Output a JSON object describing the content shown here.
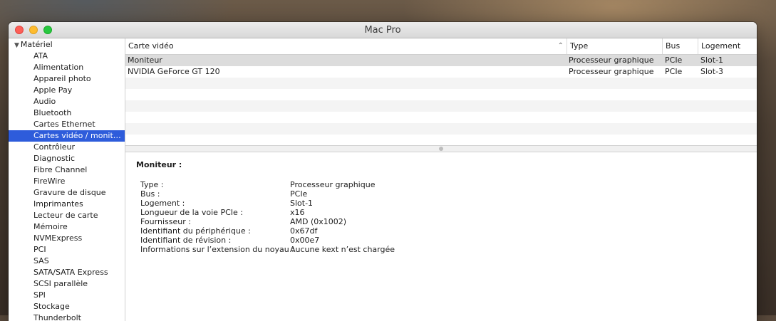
{
  "window": {
    "title": "Mac Pro"
  },
  "sidebar": {
    "header": "Matériel",
    "items": [
      {
        "label": "ATA"
      },
      {
        "label": "Alimentation"
      },
      {
        "label": "Appareil photo"
      },
      {
        "label": "Apple Pay"
      },
      {
        "label": "Audio"
      },
      {
        "label": "Bluetooth"
      },
      {
        "label": "Cartes Ethernet"
      },
      {
        "label": "Cartes vidéo / monite…"
      },
      {
        "label": "Contrôleur"
      },
      {
        "label": "Diagnostic"
      },
      {
        "label": "Fibre Channel"
      },
      {
        "label": "FireWire"
      },
      {
        "label": "Gravure de disque"
      },
      {
        "label": "Imprimantes"
      },
      {
        "label": "Lecteur de carte"
      },
      {
        "label": "Mémoire"
      },
      {
        "label": "NVMExpress"
      },
      {
        "label": "PCI"
      },
      {
        "label": "SAS"
      },
      {
        "label": "SATA/SATA Express"
      },
      {
        "label": "SCSI parallèle"
      },
      {
        "label": "SPI"
      },
      {
        "label": "Stockage"
      },
      {
        "label": "Thunderbolt"
      }
    ],
    "selected_index": 7
  },
  "table": {
    "columns": [
      "Carte vidéo",
      "Type",
      "Bus",
      "Logement"
    ],
    "rows": [
      [
        "Moniteur",
        "Processeur graphique",
        "PCIe",
        "Slot-1"
      ],
      [
        "NVIDIA GeForce GT 120",
        "Processeur graphique",
        "PCIe",
        "Slot-3"
      ]
    ]
  },
  "detail": {
    "title": "Moniteur :",
    "properties": [
      {
        "label": "Type :",
        "value": "Processeur graphique"
      },
      {
        "label": "Bus :",
        "value": "PCIe"
      },
      {
        "label": "Logement :",
        "value": "Slot-1"
      },
      {
        "label": "Longueur de la voie PCIe :",
        "value": "x16"
      },
      {
        "label": "Fournisseur :",
        "value": "AMD (0x1002)"
      },
      {
        "label": "Identifiant du périphérique :",
        "value": "0x67df"
      },
      {
        "label": "Identifiant de révision :",
        "value": "0x00e7"
      },
      {
        "label": "Informations sur l’extension du noyau :",
        "value": "Aucune kext n’est chargée"
      }
    ]
  },
  "colors": {
    "selection": "#2e5cdb",
    "row_selected": "#dcdcdc",
    "row_alt": "#f4f4f4"
  }
}
